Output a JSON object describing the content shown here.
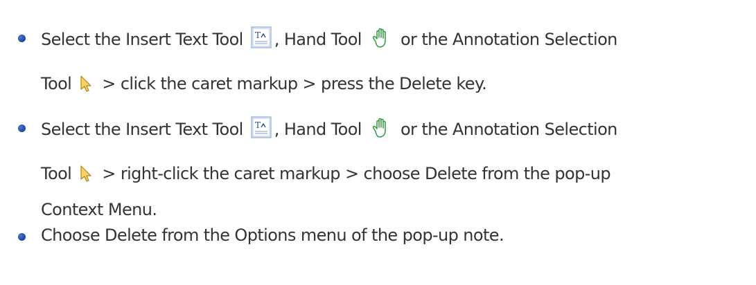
{
  "items": [
    {
      "line1": {
        "t1": "Select the Insert Text Tool",
        "t2": ", Hand Tool",
        "t3": "or the Annotation Selection"
      },
      "line2": {
        "t1": "Tool",
        "t2": "> click the caret markup > press the Delete key."
      }
    },
    {
      "line1": {
        "t1": "Select the Insert Text Tool",
        "t2": ", Hand Tool",
        "t3": "or the Annotation Selection"
      },
      "line2": {
        "t1": "Tool",
        "t2": "> right-click the caret markup > choose Delete from the pop-up"
      },
      "line3": "Context Menu."
    },
    {
      "line1": "Choose Delete from the Options menu of the pop-up note."
    }
  ],
  "icons": {
    "insert_text": "insert-text-tool-icon",
    "hand": "hand-tool-icon",
    "selection": "annotation-selection-tool-icon"
  }
}
